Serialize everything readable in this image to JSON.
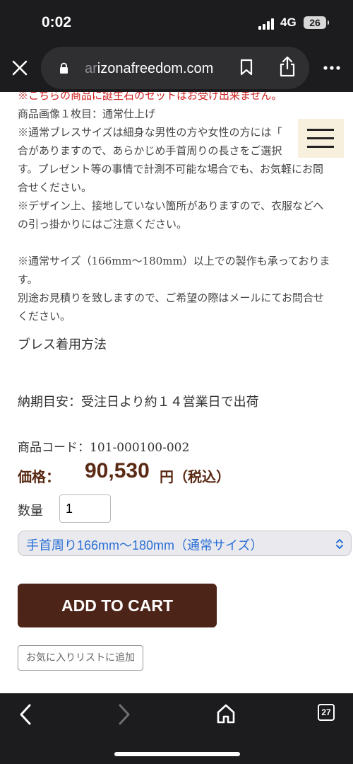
{
  "status": {
    "time": "0:02",
    "network": "4G",
    "battery": "26"
  },
  "browser": {
    "url_prefix": "ar",
    "url_domain": "izonafreedom.com",
    "tab_count": "27"
  },
  "description": {
    "line1": "※こちらの商品に誕生石のセットはお受け出来ません。",
    "line2": "商品画像１枚目：通常仕上げ",
    "line3": "※通常ブレスサイズは細身な男性の方や女性の方には「",
    "line4": "合がありますので、あらかじめ手首周りの長さをご選択",
    "line5": "す。プレゼント等の事情で計測不可能な場合でも、お気軽にお問",
    "line6": "合せください。",
    "line7": "※デザイン上、接地していない箇所がありますので、衣服などへ",
    "line8": "の引っ掛かりにはご注意ください。",
    "line9": "※通常サイズ（166mm〜180mm）以上での製作も承っておりま",
    "line10": "す。",
    "line11": "別途お見積りを致しますので、ご希望の際はメールにてお問合せ",
    "line12": "ください。"
  },
  "product": {
    "how_to_wear": "ブレス着用方法",
    "delivery": "納期目安：受注日より約１４営業日で出荷",
    "code": "商品コード：101-000100-002",
    "price_label": "価格：",
    "price_value": "90,530",
    "price_unit": "円（税込）",
    "qty_label": "数量",
    "qty_value": "1",
    "size_selected": "手首周り166mm〜180mm（通常サイズ）",
    "add_to_cart": "ADD TO CART",
    "add_to_wishlist": "お気に入りリストに追加"
  },
  "icons": {
    "close": "close-icon",
    "lock": "lock-icon",
    "bookmark": "bookmark-icon",
    "share": "share-icon",
    "more": "more-icon",
    "menu": "hamburger-menu-icon",
    "back": "back-icon",
    "forward": "forward-icon",
    "home": "home-icon",
    "tabs": "tabs-icon"
  },
  "colors": {
    "price": "#5a2a15",
    "cart_button": "#4d2418",
    "select_text": "#2a6fd6",
    "warning": "#cc2222"
  }
}
